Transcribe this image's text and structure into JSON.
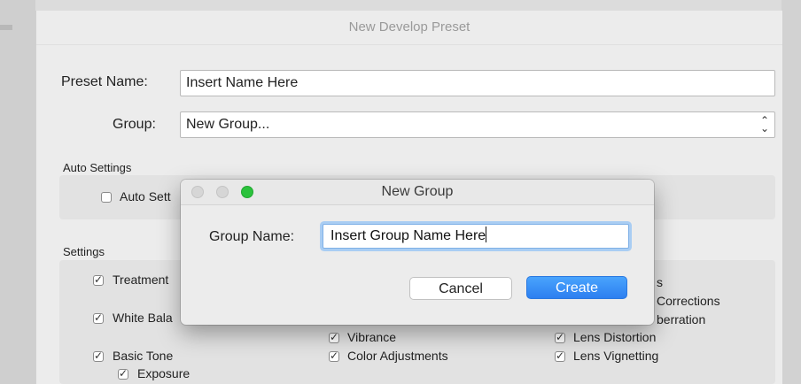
{
  "main_window": {
    "title": "New Develop Preset",
    "preset_name_label": "Preset Name:",
    "preset_name_value": "Insert Name Here",
    "group_label": "Group:",
    "group_value": "New Group...",
    "auto_settings": {
      "section_label": "Auto Settings",
      "auto_settings_checkbox_text": "Auto Sett",
      "auto_settings_checked": false
    },
    "settings": {
      "section_label": "Settings",
      "col1": [
        {
          "text": "Treatment",
          "checked": true
        },
        {
          "text": "White Bala",
          "checked": true
        },
        {
          "text": "Basic Tone",
          "checked": true
        },
        {
          "text": "Exposure",
          "checked": true
        }
      ],
      "col2": [
        {
          "text": "Vibrance",
          "checked": true
        },
        {
          "text": "Color Adjustments",
          "checked": true
        }
      ],
      "col3_partial": [
        {
          "text": "s"
        },
        {
          "text": "Corrections"
        },
        {
          "text": "berration"
        }
      ],
      "col3": [
        {
          "text": "Lens Distortion",
          "checked": true
        },
        {
          "text": "Lens Vignetting",
          "checked": true
        }
      ]
    }
  },
  "dialog": {
    "title": "New Group",
    "group_name_label": "Group Name:",
    "group_name_value": "Insert Group Name Here",
    "cancel_label": "Cancel",
    "create_label": "Create"
  },
  "colors": {
    "accent": "#2d7ff0",
    "zoom_green": "#2bc23c"
  }
}
